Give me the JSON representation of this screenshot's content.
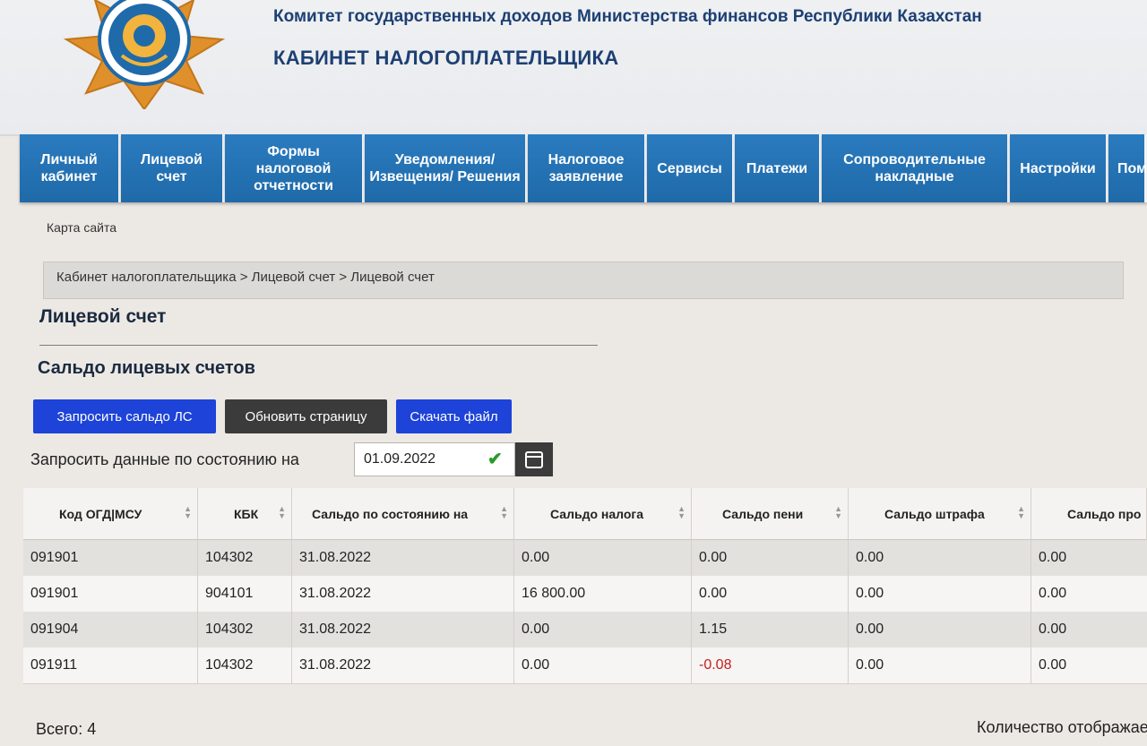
{
  "header": {
    "org_name": "Комитет государственных доходов Министерства финансов Республики Казахстан",
    "cabinet_title": "КАБИНЕТ НАЛОГОПЛАТЕЛЬЩИКА"
  },
  "nav": {
    "items": [
      {
        "label": "Личный кабинет"
      },
      {
        "label": "Лицевой счет"
      },
      {
        "label": "Формы налоговой отчетности"
      },
      {
        "label": "Уведомления/ Извещения/ Решения"
      },
      {
        "label": "Налоговое заявление"
      },
      {
        "label": "Сервисы"
      },
      {
        "label": "Платежи"
      },
      {
        "label": "Сопроводительные накладные"
      },
      {
        "label": "Настройки"
      },
      {
        "label": "Пом"
      }
    ]
  },
  "sitemap_label": "Карта сайта",
  "breadcrumb": "Кабинет налогоплательщика > Лицевой счет > Лицевой счет",
  "page_title": "Лицевой счет",
  "section_title": "Сальдо лицевых счетов",
  "buttons": {
    "request": "Запросить сальдо ЛС",
    "refresh": "Обновить страницу",
    "download": "Скачать файл"
  },
  "date_filter": {
    "label": "Запросить данные по состоянию на",
    "value": "01.09.2022"
  },
  "table": {
    "columns": [
      "Код ОГД|МСУ",
      "КБК",
      "Сальдо по состоянию на",
      "Сальдо налога",
      "Сальдо пени",
      "Сальдо штрафа",
      "Сальдо про"
    ],
    "rows": [
      [
        "091901",
        "104302",
        "31.08.2022",
        "0.00",
        "0.00",
        "0.00",
        "0.00"
      ],
      [
        "091901",
        "904101",
        "31.08.2022",
        "16 800.00",
        "0.00",
        "0.00",
        "0.00"
      ],
      [
        "091904",
        "104302",
        "31.08.2022",
        "0.00",
        "1.15",
        "0.00",
        "0.00"
      ],
      [
        "091911",
        "104302",
        "31.08.2022",
        "0.00",
        "-0.08",
        "0.00",
        "0.00"
      ]
    ]
  },
  "footer": {
    "total": "Всего: 4",
    "count_label": "Количество отображае"
  },
  "colors": {
    "nav_blue": "#2a7bbf",
    "button_blue": "#1d43d8",
    "button_dark": "#3b3b3b",
    "title_blue": "#1d3f73",
    "negative": "#c41d1d"
  }
}
